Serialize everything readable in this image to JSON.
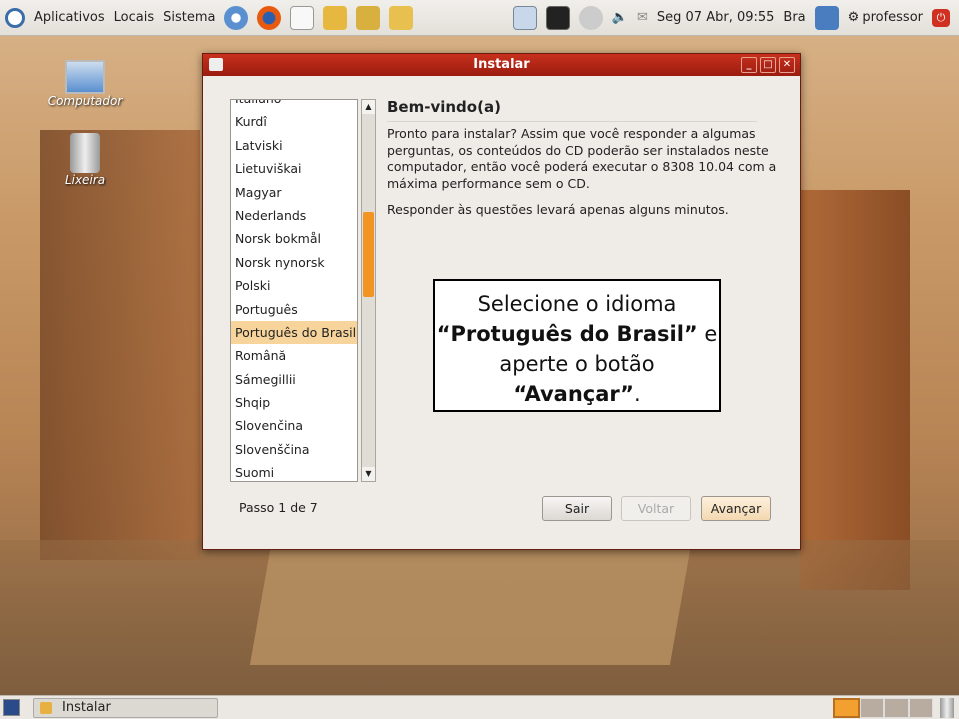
{
  "top_panel": {
    "menus": [
      "Aplicativos",
      "Locais",
      "Sistema"
    ],
    "clock": "Seg 07 Abr, 09:55",
    "keyboard": "Bra",
    "user": "professor"
  },
  "desktop": {
    "icons": [
      {
        "label": "Computador",
        "icon": "computer-icon"
      },
      {
        "label": "Lixeira",
        "icon": "trash-icon"
      }
    ]
  },
  "window": {
    "title": "Instalar",
    "languages": [
      "Italiano",
      "Kurdî",
      "Latviski",
      "Lietuviškai",
      "Magyar",
      "Nederlands",
      "Norsk bokmål",
      "Norsk nynorsk",
      "Polski",
      "Português",
      "Português do Brasil",
      "Română",
      "Sámegillii",
      "Shqip",
      "Slovenčina",
      "Slovenščina",
      "Suomi"
    ],
    "selected_language": "Português do Brasil",
    "heading": "Bem-vindo(a)",
    "paragraph1": "Pronto para instalar? Assim que você responder a algumas perguntas, os conteúdos do CD poderão ser instalados neste computador, então você poderá executar o 8308 10.04 com a máxima performance sem o CD.",
    "paragraph2": "Responder às questões levará apenas alguns minutos.",
    "step": "Passo 1 de 7",
    "buttons": {
      "quit": "Sair",
      "back": "Voltar",
      "forward": "Avançar"
    }
  },
  "annotation": {
    "line1": "Selecione o idioma",
    "quoted_lang": "“Protuguês do Brasil”",
    "line3": " e aperte o botão ",
    "quoted_btn": "“Avançar”",
    "end": "."
  },
  "bottom_panel": {
    "task": "Instalar"
  },
  "colors": {
    "title_bar": "#b0261a",
    "selection": "#f6d49b",
    "scroll_thumb": "#f29422"
  }
}
